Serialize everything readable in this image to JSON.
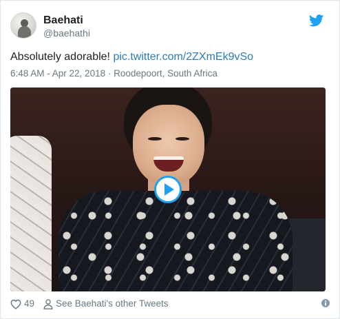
{
  "user": {
    "display_name": "Baehati",
    "handle": "@baehathi"
  },
  "tweet": {
    "text": "Absolutely adorable! ",
    "link": "pic.twitter.com/2ZXmEk9vSo",
    "meta": "6:48 AM - Apr 22, 2018 · Roodepoort, South Africa"
  },
  "footer": {
    "likes": "49",
    "profile_link": "See Baehati's other Tweets"
  },
  "colors": {
    "link": "#2b7bb9",
    "twitter_blue": "#1da1f2",
    "muted": "#697882"
  },
  "icons": {
    "logo": "twitter-bird-icon",
    "play": "play-icon",
    "like": "heart-icon",
    "profile": "person-icon",
    "info": "info-icon"
  }
}
